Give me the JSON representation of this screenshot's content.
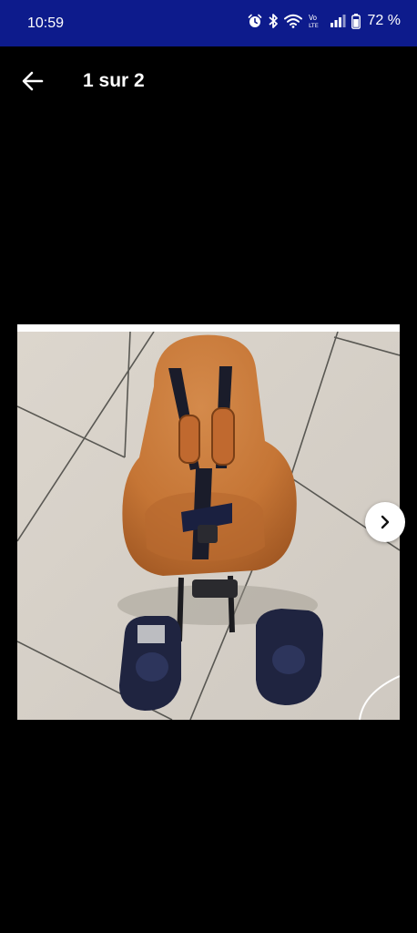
{
  "status_bar": {
    "time": "10:59",
    "battery": "72 %",
    "icons": [
      "alarm-icon",
      "bluetooth-icon",
      "wifi-icon",
      "volte-icon",
      "signal-icon",
      "battery-icon"
    ],
    "background_color": "#0d1b8c"
  },
  "app_bar": {
    "back_icon": "arrow-left-icon",
    "title": "1 sur 2"
  },
  "gallery": {
    "image": "photo of an orange child bike seat on a tiled floor",
    "next_icon": "chevron-right-icon",
    "current_index": 1,
    "total": 2
  }
}
